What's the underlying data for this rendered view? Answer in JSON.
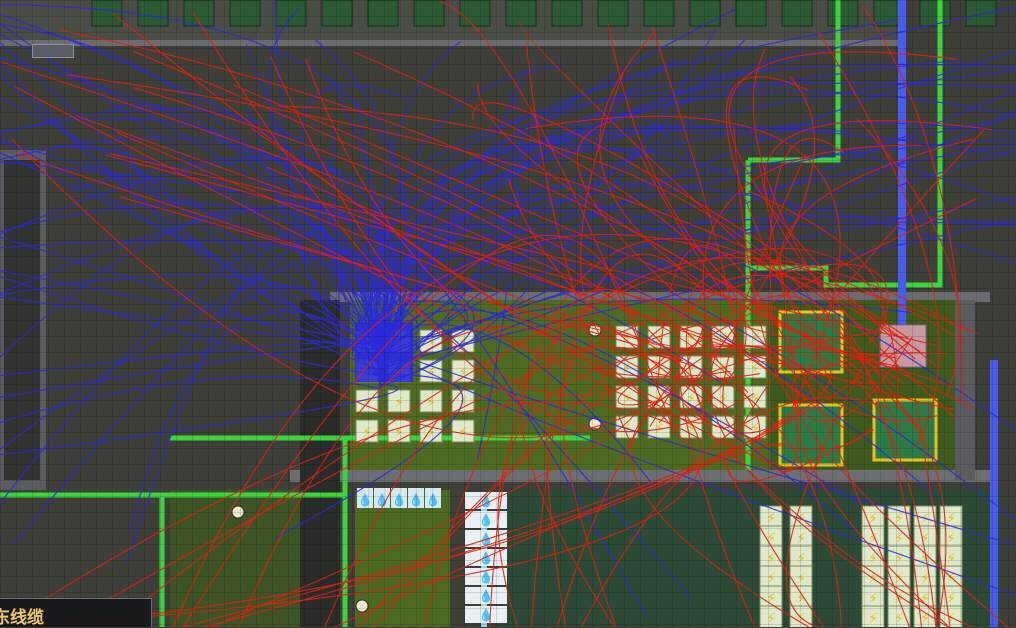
{
  "overlay": {
    "name": "power-wire-overlay",
    "wire_color": "#2a2ad8",
    "signal_color": "#e02010",
    "gas_pipe_color": "#3cd43c",
    "liquid_pipe_color": "#4a5cf0"
  },
  "tooltip": {
    "label": "东线缆"
  },
  "icons": {
    "battery": "lightning-bolt-icon",
    "water": "water-drop-icon",
    "duplicant": "duplicant-icon"
  }
}
